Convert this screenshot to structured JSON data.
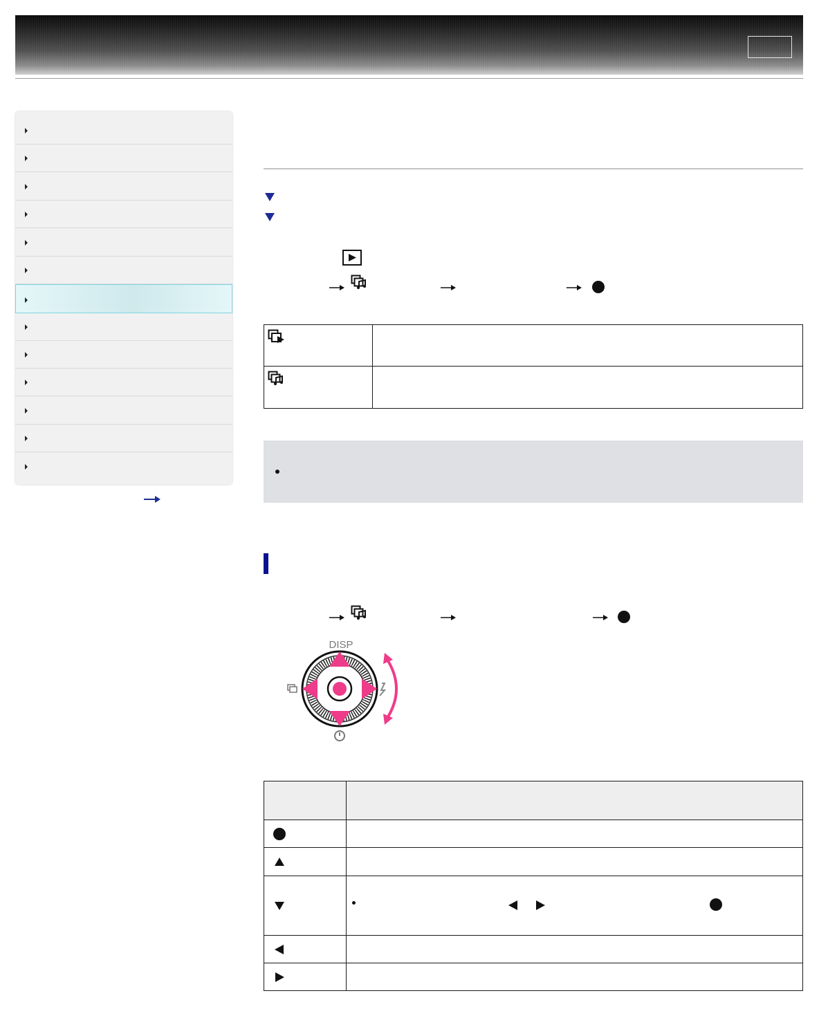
{
  "header": {
    "banner_button_label": ""
  },
  "sidebar": {
    "items": [
      {
        "label": ""
      },
      {
        "label": ""
      },
      {
        "label": ""
      },
      {
        "label": ""
      },
      {
        "label": ""
      },
      {
        "label": ""
      },
      {
        "label": "",
        "active": true
      },
      {
        "label": ""
      },
      {
        "label": ""
      },
      {
        "label": ""
      },
      {
        "label": ""
      },
      {
        "label": ""
      },
      {
        "label": ""
      }
    ],
    "more_icon": "right-arrow-icon"
  },
  "main": {
    "title": "",
    "jump_links": [
      {
        "icon": "down-triangle-icon",
        "label": ""
      },
      {
        "icon": "down-triangle-icon",
        "label": ""
      }
    ],
    "step1": {
      "text": "",
      "icon": "playback-button-icon"
    },
    "step2": {
      "icons": [
        "arrow-right-icon",
        "music-slideshow-icon",
        "arrow-right-icon",
        "arrow-right-icon",
        "center-button-icon"
      ]
    },
    "options_table": [
      {
        "icon": "slideshow-icon",
        "name": "",
        "description": ""
      },
      {
        "icon": "music-slideshow-icon",
        "name": "",
        "description": ""
      }
    ],
    "note": {
      "bullets": [
        ""
      ]
    },
    "section": {
      "heading": "",
      "step": {
        "icons": [
          "arrow-right-icon",
          "music-slideshow-icon",
          "arrow-right-icon",
          "arrow-right-icon",
          "center-button-icon"
        ]
      },
      "dial": {
        "top_label": "DISP"
      },
      "controls_table": {
        "headers": [
          "",
          ""
        ],
        "rows": [
          {
            "icon": "center-button-icon",
            "action": ""
          },
          {
            "icon": "up-triangle-icon",
            "action": ""
          },
          {
            "icon": "down-triangle-icon",
            "action": "",
            "inline_icons": [
              "bullet-icon",
              "left-triangle-icon",
              "right-triangle-icon",
              "center-button-icon"
            ]
          },
          {
            "icon": "left-triangle-icon",
            "action": ""
          },
          {
            "icon": "right-triangle-icon",
            "action": ""
          }
        ]
      }
    }
  },
  "colors": {
    "accent_pink": "#ee3b8a",
    "link_blue": "#1e2c96",
    "section_bar": "#0b1290",
    "active_bg": "#d6eef1",
    "note_bg": "#dee0e3"
  }
}
